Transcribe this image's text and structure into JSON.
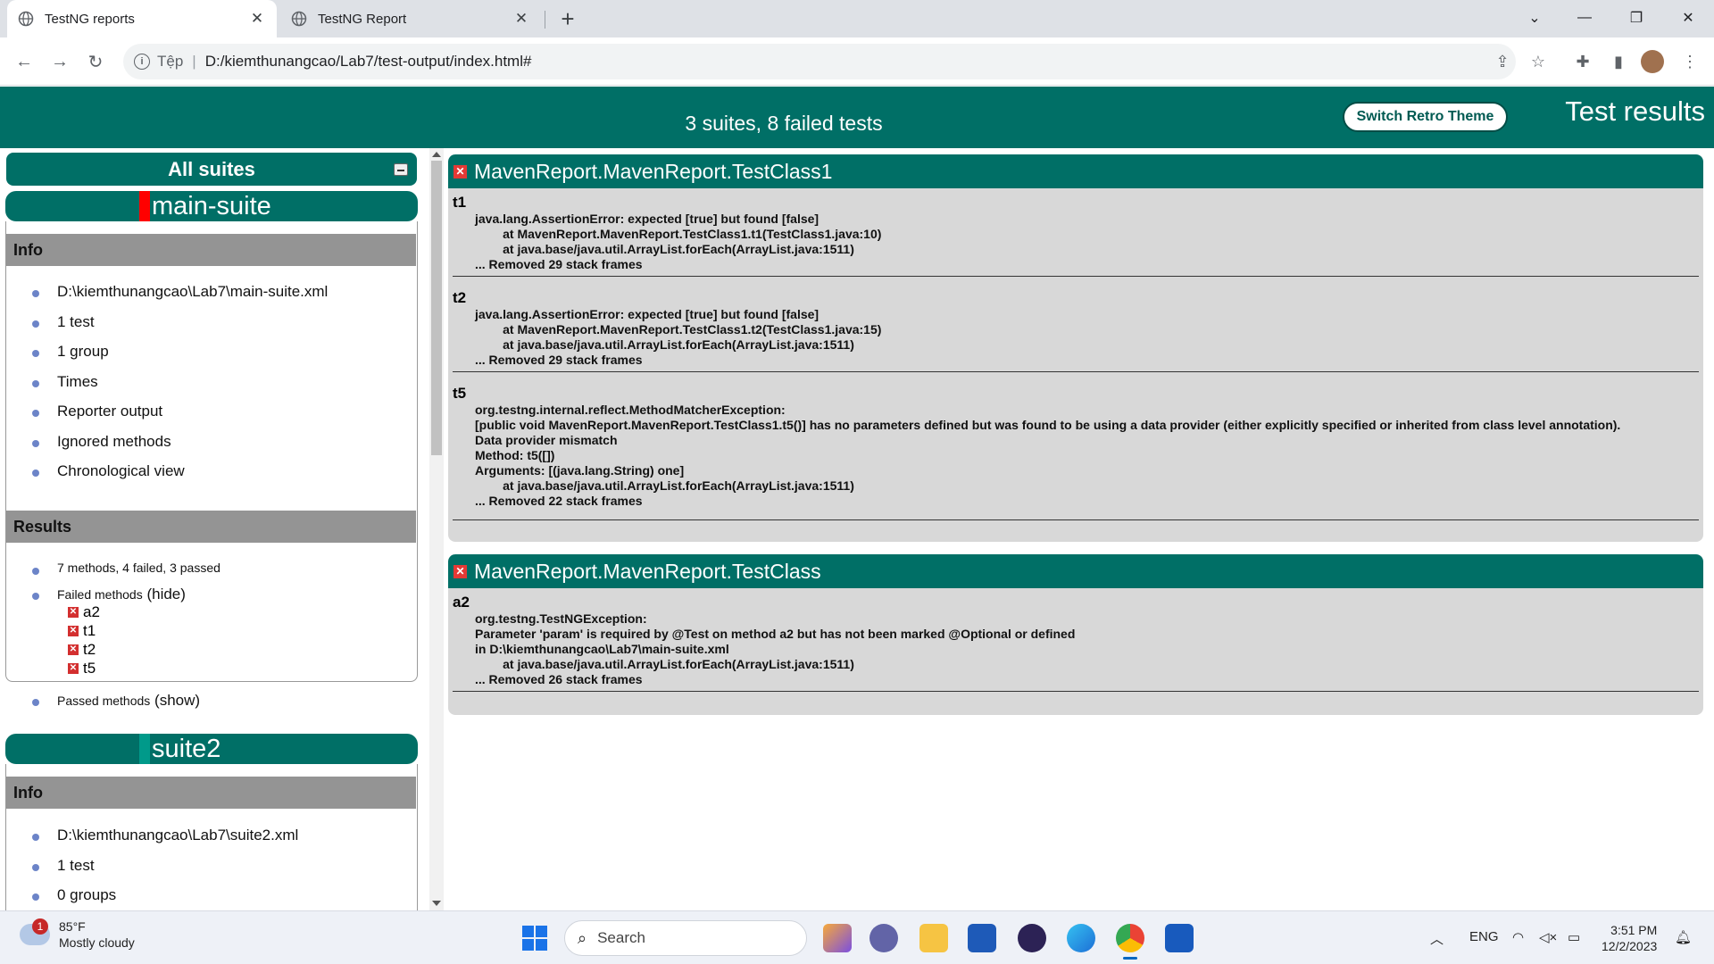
{
  "browser": {
    "tabs": [
      {
        "title": "TestNG reports",
        "active": true
      },
      {
        "title": "TestNG Report",
        "active": false
      }
    ],
    "new_tab_symbol": "+",
    "address": {
      "scheme_label": "Tệp",
      "url": "D:/kiemthunangcao/Lab7/test-output/index.html#"
    },
    "icons": [
      "back-icon",
      "forward-icon",
      "reload-icon",
      "info-icon",
      "share-icon",
      "star-icon",
      "extensions-icon",
      "sidepanel-icon",
      "profile-avatar",
      "menu-icon"
    ]
  },
  "report": {
    "summary": "3 suites, 8 failed tests",
    "retro_button": "Switch Retro Theme",
    "title": "Test results",
    "navigator": {
      "all_suites": "All suites",
      "suites": [
        {
          "name": "main-suite",
          "status_color": "#ff0000",
          "info_heading": "Info",
          "info_items": [
            "D:\\kiemthunangcao\\Lab7\\main-suite.xml",
            "1 test",
            "1 group",
            "Times",
            "Reporter output",
            "Ignored methods",
            "Chronological view"
          ],
          "results_heading": "Results",
          "results_summary": "7 methods, 4 failed, 3 passed",
          "failed_label": "Failed methods",
          "failed_toggle": "(hide)",
          "failed_methods": [
            "a2",
            "t1",
            "t2",
            "t5"
          ],
          "passed_label": "Passed methods",
          "passed_toggle": "(show)"
        },
        {
          "name": "suite2",
          "status_color": "#009a8a",
          "info_heading": "Info",
          "info_items": [
            "D:\\kiemthunangcao\\Lab7\\suite2.xml",
            "1 test",
            "0 groups"
          ]
        }
      ]
    },
    "panels": [
      {
        "class_name": "MavenReport.MavenReport.TestClass1",
        "methods": [
          {
            "name": "t1",
            "stack": "java.lang.AssertionError: expected [true] but found [false]\n        at MavenReport.MavenReport.TestClass1.t1(TestClass1.java:10)\n        at java.base/java.util.ArrayList.forEach(ArrayList.java:1511)\n... Removed 29 stack frames"
          },
          {
            "name": "t2",
            "stack": "java.lang.AssertionError: expected [true] but found [false]\n        at MavenReport.MavenReport.TestClass1.t2(TestClass1.java:15)\n        at java.base/java.util.ArrayList.forEach(ArrayList.java:1511)\n... Removed 29 stack frames"
          },
          {
            "name": "t5",
            "stack": "org.testng.internal.reflect.MethodMatcherException:\n[public void MavenReport.MavenReport.TestClass1.t5()] has no parameters defined but was found to be using a data provider (either explicitly specified or inherited from class level annotation).\nData provider mismatch\nMethod: t5([])\nArguments: [(java.lang.String) one]\n        at java.base/java.util.ArrayList.forEach(ArrayList.java:1511)\n... Removed 22 stack frames"
          }
        ]
      },
      {
        "class_name": "MavenReport.MavenReport.TestClass",
        "methods": [
          {
            "name": "a2",
            "stack": "org.testng.TestNGException:\nParameter 'param' is required by @Test on method a2 but has not been marked @Optional or defined\nin D:\\kiemthunangcao\\Lab7\\main-suite.xml\n        at java.base/java.util.ArrayList.forEach(ArrayList.java:1511)\n... Removed 26 stack frames"
          }
        ]
      }
    ]
  },
  "taskbar": {
    "weather_temp": "85°F",
    "weather_desc": "Mostly cloudy",
    "weather_badge": "1",
    "search_placeholder": "Search",
    "tray_lang": "ENG",
    "time": "3:51 PM",
    "date": "12/2/2023"
  },
  "colors": {
    "header_green": "#006f66",
    "fail_red": "#e53935",
    "panel_gray": "#d8d8d8",
    "section_gray": "#949494"
  }
}
